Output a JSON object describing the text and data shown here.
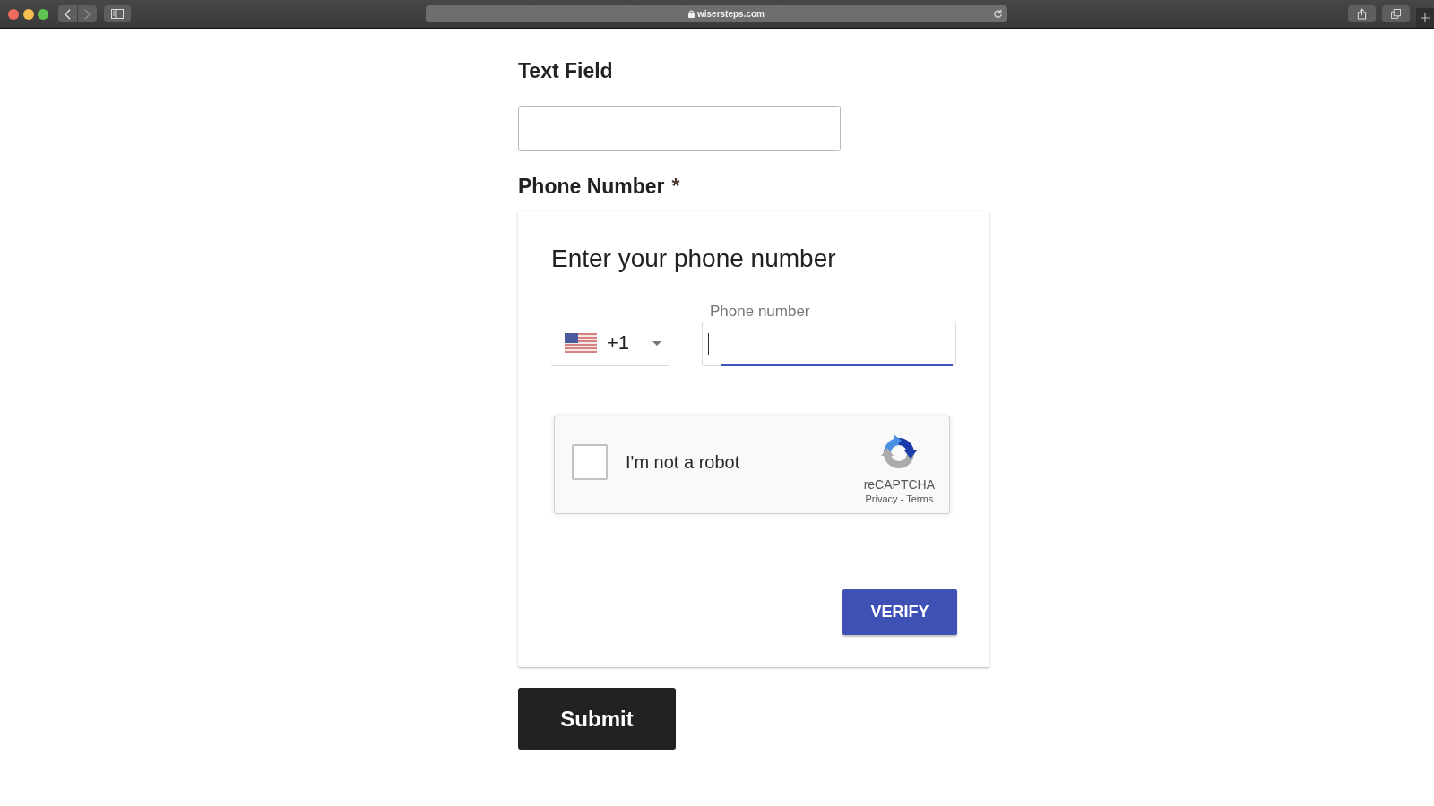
{
  "browser": {
    "forward_disabled": true,
    "address": "wisersteps.com"
  },
  "form": {
    "text_field": {
      "label": "Text Field"
    },
    "phone_field": {
      "label": "Phone Number",
      "required_mark": "*",
      "card": {
        "title": "Enter your phone number",
        "country_code": "+1",
        "phone_input": {
          "label": "Phone number",
          "focused": true
        },
        "recaptcha": {
          "label": "I'm not a robot",
          "checked": false,
          "brand": "reCAPTCHA",
          "links": [
            "Privacy",
            "Terms"
          ],
          "separator": "-"
        },
        "verify_button": "VERIFY"
      }
    },
    "submit_button": "Submit"
  }
}
